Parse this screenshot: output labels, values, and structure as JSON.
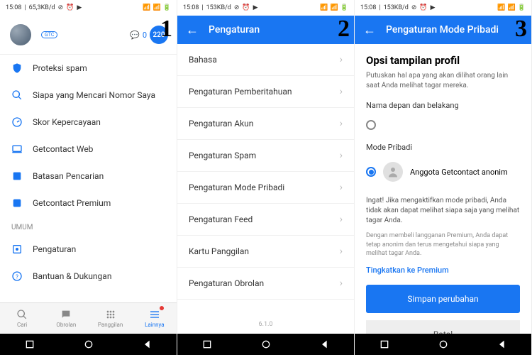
{
  "status": {
    "time": "15:08",
    "net1": "65,3KB/d",
    "net2": "153KB/d"
  },
  "steps": {
    "one": "1",
    "two": "2",
    "three": "3"
  },
  "screen1": {
    "gtc": "GTC",
    "chat_count": "0",
    "badge": "220",
    "menu": {
      "spam": "Proteksi spam",
      "who": "Siapa yang Mencari Nomor Saya",
      "trust": "Skor Kepercayaan",
      "web": "Getcontact Web",
      "limit": "Batasan Pencarian",
      "premium": "Getcontact Premium"
    },
    "section_general": "UMUM",
    "general": {
      "settings": "Pengaturan",
      "help": "Bantuan & Dukungan"
    },
    "nav": {
      "search": "Cari",
      "chat": "Obrolan",
      "calls": "Panggilan",
      "more": "Lainnya"
    }
  },
  "screen2": {
    "title": "Pengaturan",
    "items": {
      "lang": "Bahasa",
      "notif": "Pengaturan Pemberitahuan",
      "account": "Pengaturan Akun",
      "spam": "Pengaturan Spam",
      "private": "Pengaturan Mode Pribadi",
      "feed": "Pengaturan Feed",
      "callcard": "Kartu Panggilan",
      "chat": "Pengaturan Obrolan"
    },
    "version": "6.1.0"
  },
  "screen3": {
    "title": "Pengaturan Mode Pribadi",
    "heading": "Opsi tampilan profil",
    "sub": "Putuskan hal apa yang akan dilihat orang lain saat Anda melihat tagar mereka.",
    "opt1_label": "Nama depan dan belakang",
    "opt2_label": "Mode Pribadi",
    "opt2_text": "Anggota Getcontact anonim",
    "note": "Ingat! Jika mengaktifkan mode pribadi, Anda tidak akan dapat melihat siapa saja yang melihat tagar Anda.",
    "note2": "Dengan membeli langganan Premium, Anda dapat tetap anonim dan terus mengetahui siapa yang melihat tagar Anda.",
    "link": "Tingkatkan ke Premium",
    "save": "Simpan perubahan",
    "cancel": "Batal"
  }
}
